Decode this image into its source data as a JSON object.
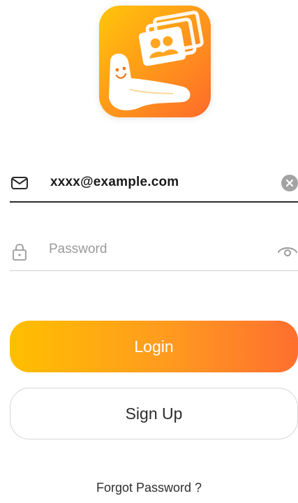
{
  "logo": {
    "icon": "app-logo-hand-photos",
    "colors": {
      "start": "#FFC60A",
      "end": "#FF6B2A"
    }
  },
  "email_field": {
    "icon": "mail-icon",
    "value": "xxxx@example.com",
    "clear_icon": "clear-icon"
  },
  "password_field": {
    "icon": "lock-icon",
    "placeholder": "Password",
    "toggle_icon": "eye-icon"
  },
  "buttons": {
    "login_label": "Login",
    "signup_label": "Sign Up"
  },
  "links": {
    "forgot_password": "Forgot Password ?"
  },
  "theme": {
    "accent_start": "#FFBF00",
    "accent_end": "#FF6F2F",
    "text_primary": "#1B1B1B",
    "text_placeholder": "#9A9A9A",
    "divider_active": "#2B2B2B",
    "divider": "#CFCFCF"
  }
}
